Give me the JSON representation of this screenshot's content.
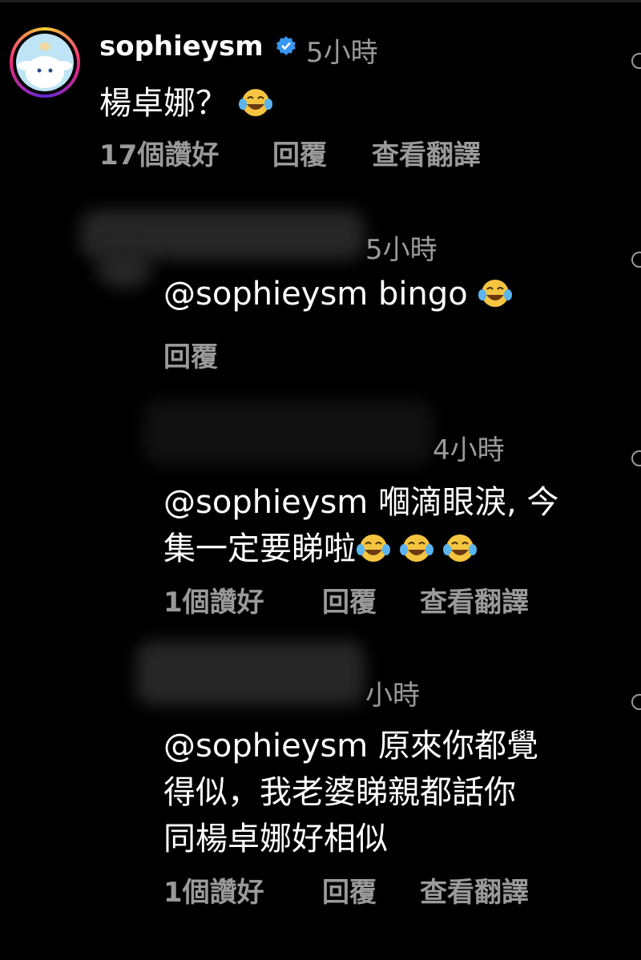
{
  "comments": [
    {
      "username": "sophieysm",
      "time": "5小時",
      "text": "楊卓娜？",
      "likes": "17個讚好",
      "reply": "回覆",
      "translate": "查看翻譯"
    },
    {
      "time": "5小時",
      "mention": "@sophieysm",
      "text": " bingo",
      "reply": "回覆"
    },
    {
      "time": "4小時",
      "line1": "@sophieysm 嗰滴眼淚, 今",
      "line2": "集一定要睇啦",
      "likes": "1個讚好",
      "reply": "回覆",
      "translate": "查看翻譯"
    },
    {
      "time": "小時",
      "line1": "@sophieysm 原來你都覺",
      "line2": "得似，我老婆睇親都話你",
      "line3": "同楊卓娜好相似",
      "likes": "1個讚好",
      "reply": "回覆",
      "translate": "查看翻譯"
    }
  ],
  "icons": {
    "verified": "verified-badge-icon",
    "emoji": "face-with-tears-of-joy-icon",
    "like": "heart-icon"
  },
  "colors": {
    "background": "#000000",
    "secondary_text": "#9a9a9a",
    "verified": "#3897f0"
  }
}
